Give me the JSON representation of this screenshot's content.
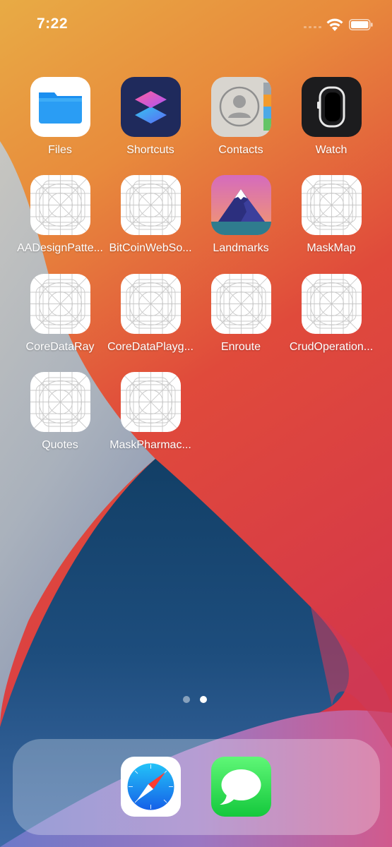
{
  "status_bar": {
    "time": "7:22"
  },
  "home": {
    "apps": [
      {
        "label": "Files",
        "icon": "files-icon"
      },
      {
        "label": "Shortcuts",
        "icon": "shortcuts-icon"
      },
      {
        "label": "Contacts",
        "icon": "contacts-icon"
      },
      {
        "label": "Watch",
        "icon": "watch-icon"
      },
      {
        "label": "AADesignPatte...",
        "icon": "placeholder-app-icon"
      },
      {
        "label": "BitCoinWebSo...",
        "icon": "placeholder-app-icon"
      },
      {
        "label": "Landmarks",
        "icon": "landmarks-icon"
      },
      {
        "label": "MaskMap",
        "icon": "placeholder-app-icon"
      },
      {
        "label": "CoreDataRay",
        "icon": "placeholder-app-icon"
      },
      {
        "label": "CoreDataPlayg...",
        "icon": "placeholder-app-icon"
      },
      {
        "label": "Enroute",
        "icon": "placeholder-app-icon"
      },
      {
        "label": "CrudOperation...",
        "icon": "placeholder-app-icon"
      },
      {
        "label": "Quotes",
        "icon": "placeholder-app-icon"
      },
      {
        "label": "MaskPharmac...",
        "icon": "placeholder-app-icon"
      }
    ],
    "page_indicator": {
      "pages": 2,
      "current": 2
    }
  },
  "dock": {
    "apps": [
      {
        "icon": "safari-icon"
      },
      {
        "icon": "messages-icon"
      }
    ]
  }
}
